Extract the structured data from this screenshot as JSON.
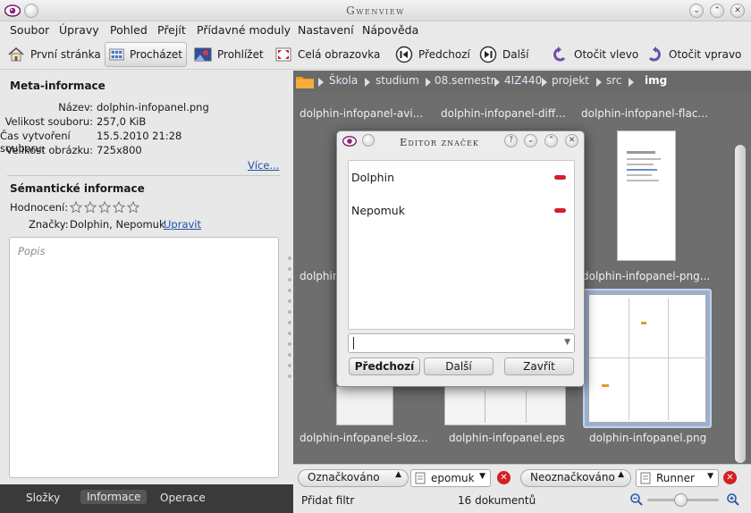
{
  "window": {
    "title": "Gwenview"
  },
  "menu": [
    "Soubor",
    "Úpravy",
    "Pohled",
    "Přejít",
    "Přídavné moduly",
    "Nastavení",
    "Nápověda"
  ],
  "toolbar": {
    "first_page": "První stránka",
    "browse": "Procházet",
    "view": "Prohlížet",
    "fullscreen": "Celá obrazovka",
    "previous": "Předchozí",
    "next": "Další",
    "rotate_left": "Otočit vlevo",
    "rotate_right": "Otočit vpravo"
  },
  "meta": {
    "heading": "Meta-informace",
    "name_label": "Název:",
    "name_value": "dolphin-infopanel.png",
    "size_label": "Velikost souboru:",
    "size_value": "257,0 KiB",
    "created_label": "Čas vytvoření souboru:",
    "created_value": "15.5.2010 21:28",
    "dims_label": "Velikost obrázku:",
    "dims_value": "725x800",
    "more": "Více..."
  },
  "semantic": {
    "heading": "Sémantické informace",
    "rating_label": "Hodnocení:",
    "rating": 0,
    "tags_label": "Značky:",
    "tags_value": "Dolphin, Nepomuk",
    "edit": "Upravit",
    "description_placeholder": "Popis"
  },
  "bottom_tabs": [
    "Složky",
    "Informace",
    "Operace"
  ],
  "breadcrumb": [
    "Škola",
    "studium",
    "08.semestr",
    "4IZ440",
    "projekt",
    "src",
    "img"
  ],
  "thumbnails": {
    "row1": [
      "dolphin-infopanel-avi...",
      "dolphin-infopanel-diff...",
      "dolphin-infopanel-flac..."
    ],
    "row2": [
      "dolphin-infopanel-png..."
    ],
    "row2_left": "dolphin",
    "row3": [
      "dolphin-infopanel-sloz...",
      "dolphin-infopanel.eps",
      "dolphin-infopanel.png"
    ]
  },
  "filters": {
    "tagged": "Označkováno",
    "tag1": "epomuk",
    "untagged": "Neoznačkováno",
    "tag2": "Runner",
    "add_filter": "Přidat filtr",
    "doc_count": "16 dokumentů"
  },
  "dialog": {
    "title": "Editor značek",
    "tags": [
      "Dolphin",
      "Nepomuk"
    ],
    "prev": "Předchozí",
    "next": "Další",
    "close": "Zavřít"
  },
  "colors": {
    "accent_red": "#d0202a",
    "link": "#1f4fa8",
    "folder_orange": "#f39a1e"
  }
}
